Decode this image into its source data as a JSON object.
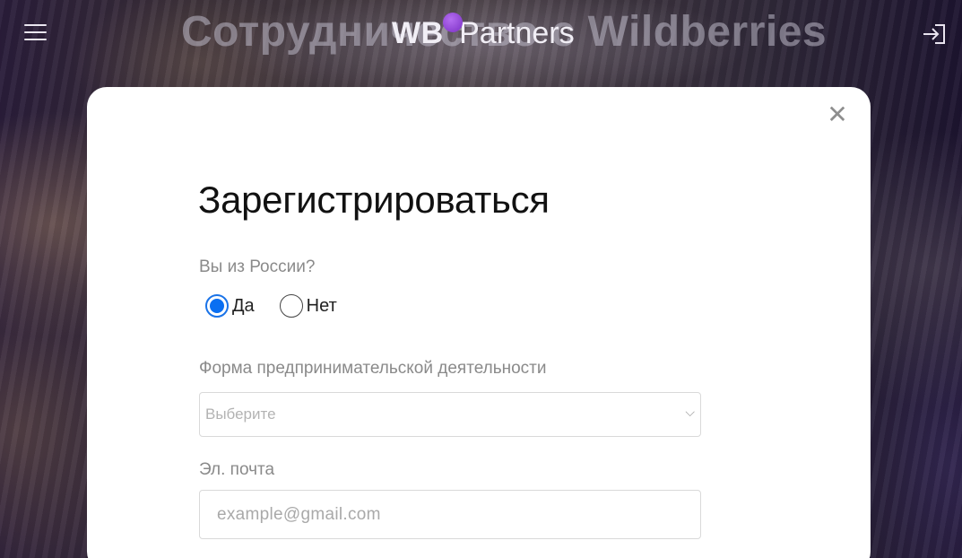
{
  "background": {
    "title": "Сотрудничество с Wildberries"
  },
  "header": {
    "logo_wb": "WB",
    "logo_partners": "Partners",
    "menu_icon": "hamburger-menu-icon",
    "login_icon": "login-icon"
  },
  "modal": {
    "close_symbol": "✕",
    "title": "Зарегистрироваться",
    "russia_question": "Вы из России?",
    "radio_yes": "Да",
    "radio_no": "Нет",
    "radio_selected": "Да",
    "business_form_label": "Форма предпринимательской деятельности",
    "business_form_value": "Выберите",
    "chevron": "⌵",
    "email_label": "Эл. почта",
    "email_placeholder": "example@gmail.com",
    "email_value": ""
  },
  "colors": {
    "accent": "#0a6ff2",
    "logo_dot": "#9b4de0"
  }
}
